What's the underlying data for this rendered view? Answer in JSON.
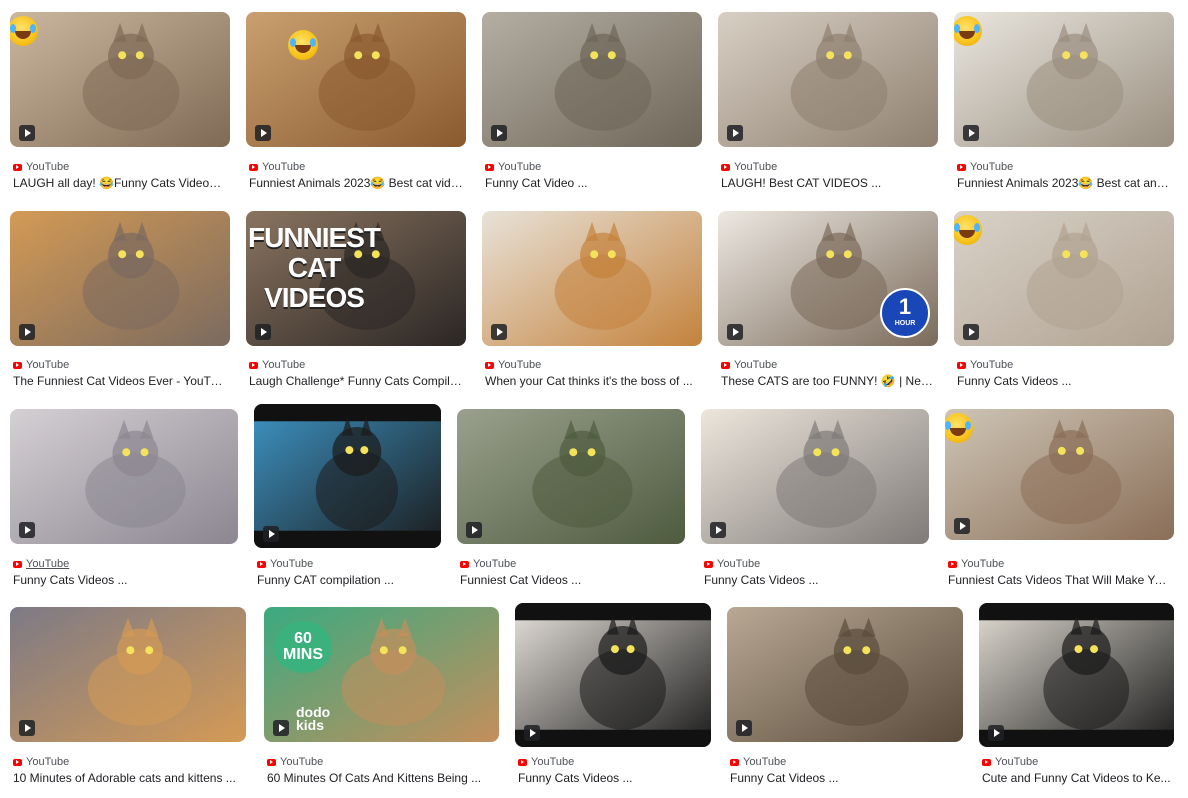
{
  "results": [
    {
      "source": "YouTube",
      "title": "LAUGH all day! 😂Funny Cats Videos ...",
      "emoji": true
    },
    {
      "source": "YouTube",
      "title": "Funniest Animals 2023😂 Best cat vide...",
      "emoji": true
    },
    {
      "source": "YouTube",
      "title": "Funny Cat Video ...",
      "emoji": false
    },
    {
      "source": "YouTube",
      "title": "LAUGH! Best CAT VIDEOS ...",
      "emoji": false
    },
    {
      "source": "YouTube",
      "title": "Funniest Animals 2023😂 Best cat and ...",
      "emoji": true
    },
    {
      "source": "YouTube",
      "title": "The Funniest Cat Videos Ever - YouTube",
      "emoji": false
    },
    {
      "source": "YouTube",
      "title": "Laugh Challenge* Funny Cats Compilat...",
      "overlay": "FUNNIEST\nCAT\nVIDEOS"
    },
    {
      "source": "YouTube",
      "title": "When your Cat thinks it's the boss of ...",
      "emoji": false
    },
    {
      "source": "YouTube",
      "title": "These CATS are too FUNNY! 🤣 | New...",
      "badge": {
        "num": "1",
        "unit": "HOUR"
      }
    },
    {
      "source": "YouTube",
      "title": "Funny Cats Videos ...",
      "emoji": true
    },
    {
      "source": "YouTube",
      "title": "Funny Cats Videos ...",
      "emoji": false
    },
    {
      "source": "YouTube",
      "title": "Funny CAT compilation ...",
      "emoji": false
    },
    {
      "source": "YouTube",
      "title": "Funniest Cat Videos ...",
      "emoji": false
    },
    {
      "source": "YouTube",
      "title": "Funny Cats Videos ...",
      "emoji": false
    },
    {
      "source": "YouTube",
      "title": "Funniest Cats Videos That Will Make You...",
      "emoji": true
    },
    {
      "source": "YouTube",
      "title": "10 Minutes of Adorable cats and kittens ...",
      "emoji": false
    },
    {
      "source": "YouTube",
      "title": "60 Minutes Of Cats And Kittens Being ...",
      "bubble": "60\nMINS",
      "brand": "dodo\nkids"
    },
    {
      "source": "YouTube",
      "title": "Funny Cats Videos ...",
      "emoji": false
    },
    {
      "source": "YouTube",
      "title": "Funny Cat Videos ...",
      "emoji": false
    },
    {
      "source": "YouTube",
      "title": "Cute and Funny Cat Videos to Ke...",
      "emoji": false
    }
  ],
  "colors": {
    "youtube_red": "#ff0000",
    "source_text": "#4d5156",
    "title_text": "#202124"
  },
  "icons": {
    "play": "play-icon",
    "source": "youtube-icon",
    "laughing": "laughing-emoji-icon"
  }
}
